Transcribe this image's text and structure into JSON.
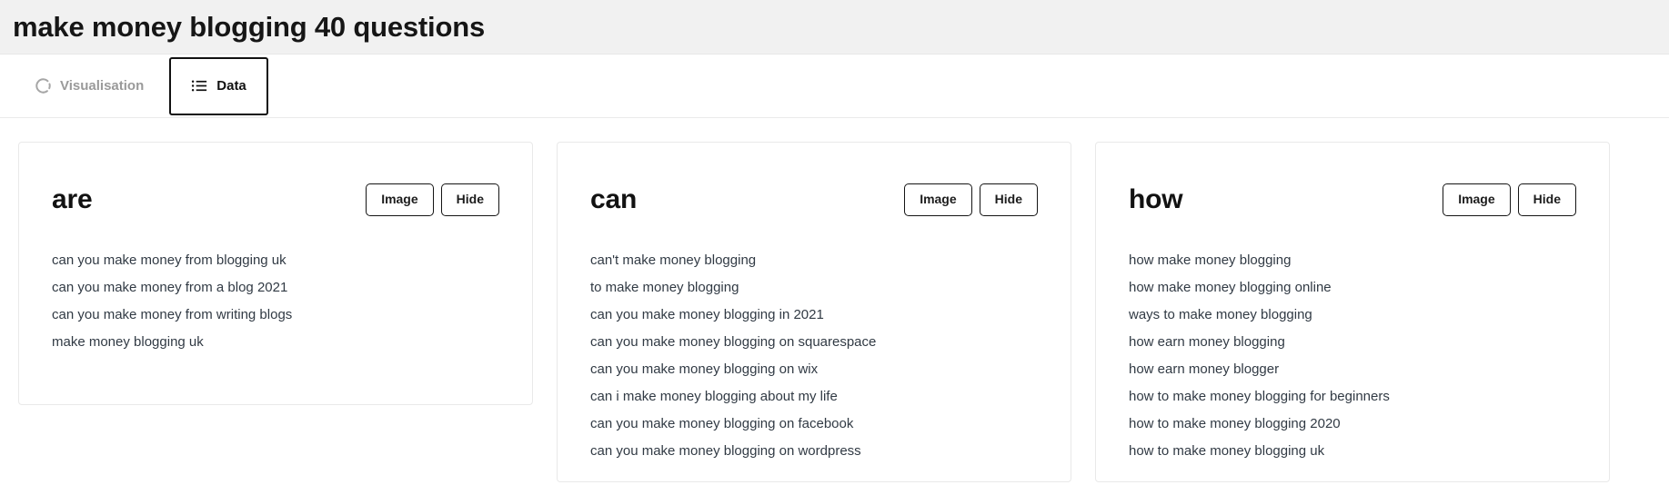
{
  "header": {
    "title": "make money blogging 40 questions",
    "background": "#f1f1f1"
  },
  "tabs": [
    {
      "label": "Visualisation",
      "icon": "spinner-circle-icon",
      "active": false
    },
    {
      "label": "Data",
      "icon": "list-icon",
      "active": true
    }
  ],
  "buttons": {
    "image_label": "Image",
    "hide_label": "Hide"
  },
  "theme": {
    "accent": "#111111",
    "card_border": "#e9e9e9",
    "text": "#313a44",
    "muted_text": "#9a9a9a"
  },
  "cards": [
    {
      "title": "are",
      "items": [
        "can you make money from blogging uk",
        "can you make money from a blog 2021",
        "can you make money from writing blogs",
        "make money blogging uk"
      ]
    },
    {
      "title": "can",
      "items": [
        "can't make money blogging",
        "to make money blogging",
        "can you make money blogging in 2021",
        "can you make money blogging on squarespace",
        "can you make money blogging on wix",
        "can i make money blogging about my life",
        "can you make money blogging on facebook",
        "can you make money blogging on wordpress"
      ]
    },
    {
      "title": "how",
      "items": [
        "how make money blogging",
        "how make money blogging online",
        "ways to make money blogging",
        "how earn money blogging",
        "how earn money blogger",
        "how to make money blogging for beginners",
        "how to make money blogging 2020",
        "how to make money blogging uk"
      ]
    }
  ]
}
